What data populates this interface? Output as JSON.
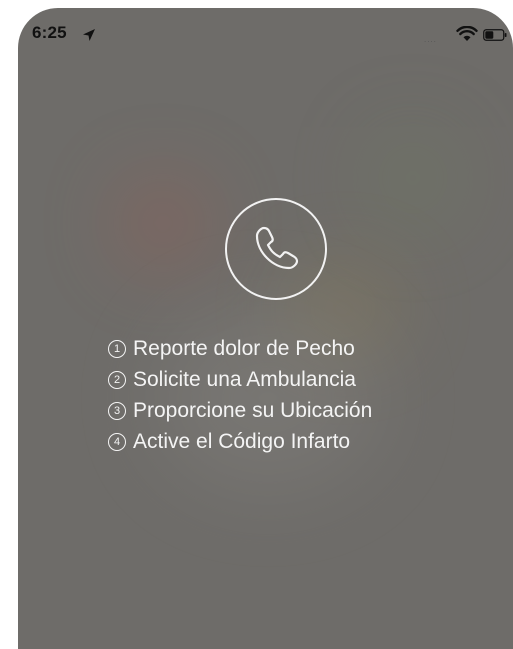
{
  "status_bar": {
    "time": "6:25",
    "signal_dots": "....",
    "icons": [
      "location-arrow-icon",
      "wifi-icon",
      "battery-icon"
    ]
  },
  "call_icon": "phone-icon",
  "steps": [
    {
      "number": "1",
      "label": "Reporte dolor de Pecho"
    },
    {
      "number": "2",
      "label": "Solicite una Ambulancia"
    },
    {
      "number": "3",
      "label": "Proporcione su Ubicación"
    },
    {
      "number": "4",
      "label": "Active el Código Infarto"
    }
  ],
  "colors": {
    "overlay": "#6e6c69",
    "text": "#f4f4f4",
    "status_text": "#111111"
  }
}
